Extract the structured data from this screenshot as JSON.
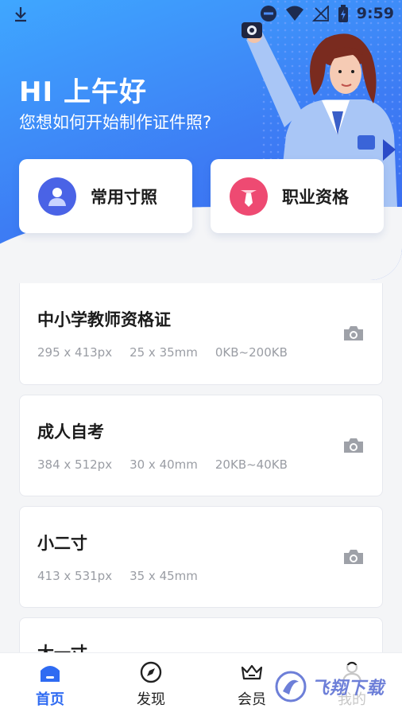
{
  "status_bar": {
    "time": "9:59",
    "icons": [
      "download-icon",
      "dnd-icon",
      "wifi-icon",
      "signal-off-icon",
      "battery-charging-icon"
    ]
  },
  "header": {
    "greeting": "HI 上午好",
    "subtitle": "您想如何开始制作证件照?"
  },
  "categories": [
    {
      "label": "常用寸照",
      "icon": "person-icon",
      "color": "#4a63e6"
    },
    {
      "label": "职业资格",
      "icon": "tie-icon",
      "color": "#ee4a72"
    }
  ],
  "list": [
    {
      "title": "中小学教师资格证",
      "pixels": "295 x 413px",
      "size": "25 x 35mm",
      "filesize": "0KB~200KB"
    },
    {
      "title": "成人自考",
      "pixels": "384 x 512px",
      "size": "30 x 40mm",
      "filesize": "20KB~40KB"
    },
    {
      "title": "小二寸",
      "pixels": "413 x 531px",
      "size": "35 x 45mm",
      "filesize": ""
    },
    {
      "title": "大一寸",
      "pixels": "",
      "size": "",
      "filesize": ""
    }
  ],
  "bottom_nav": [
    {
      "label": "首页",
      "icon": "home-icon",
      "active": true
    },
    {
      "label": "发现",
      "icon": "compass-icon",
      "active": false
    },
    {
      "label": "会员",
      "icon": "crown-icon",
      "active": false
    },
    {
      "label": "我的",
      "icon": "user-icon",
      "active": false
    }
  ],
  "watermark": {
    "text": "飞翔下载"
  },
  "colors": {
    "primary": "#2f6bf2",
    "gradient_start": "#3fa7ff",
    "gradient_end": "#3a67ee"
  }
}
